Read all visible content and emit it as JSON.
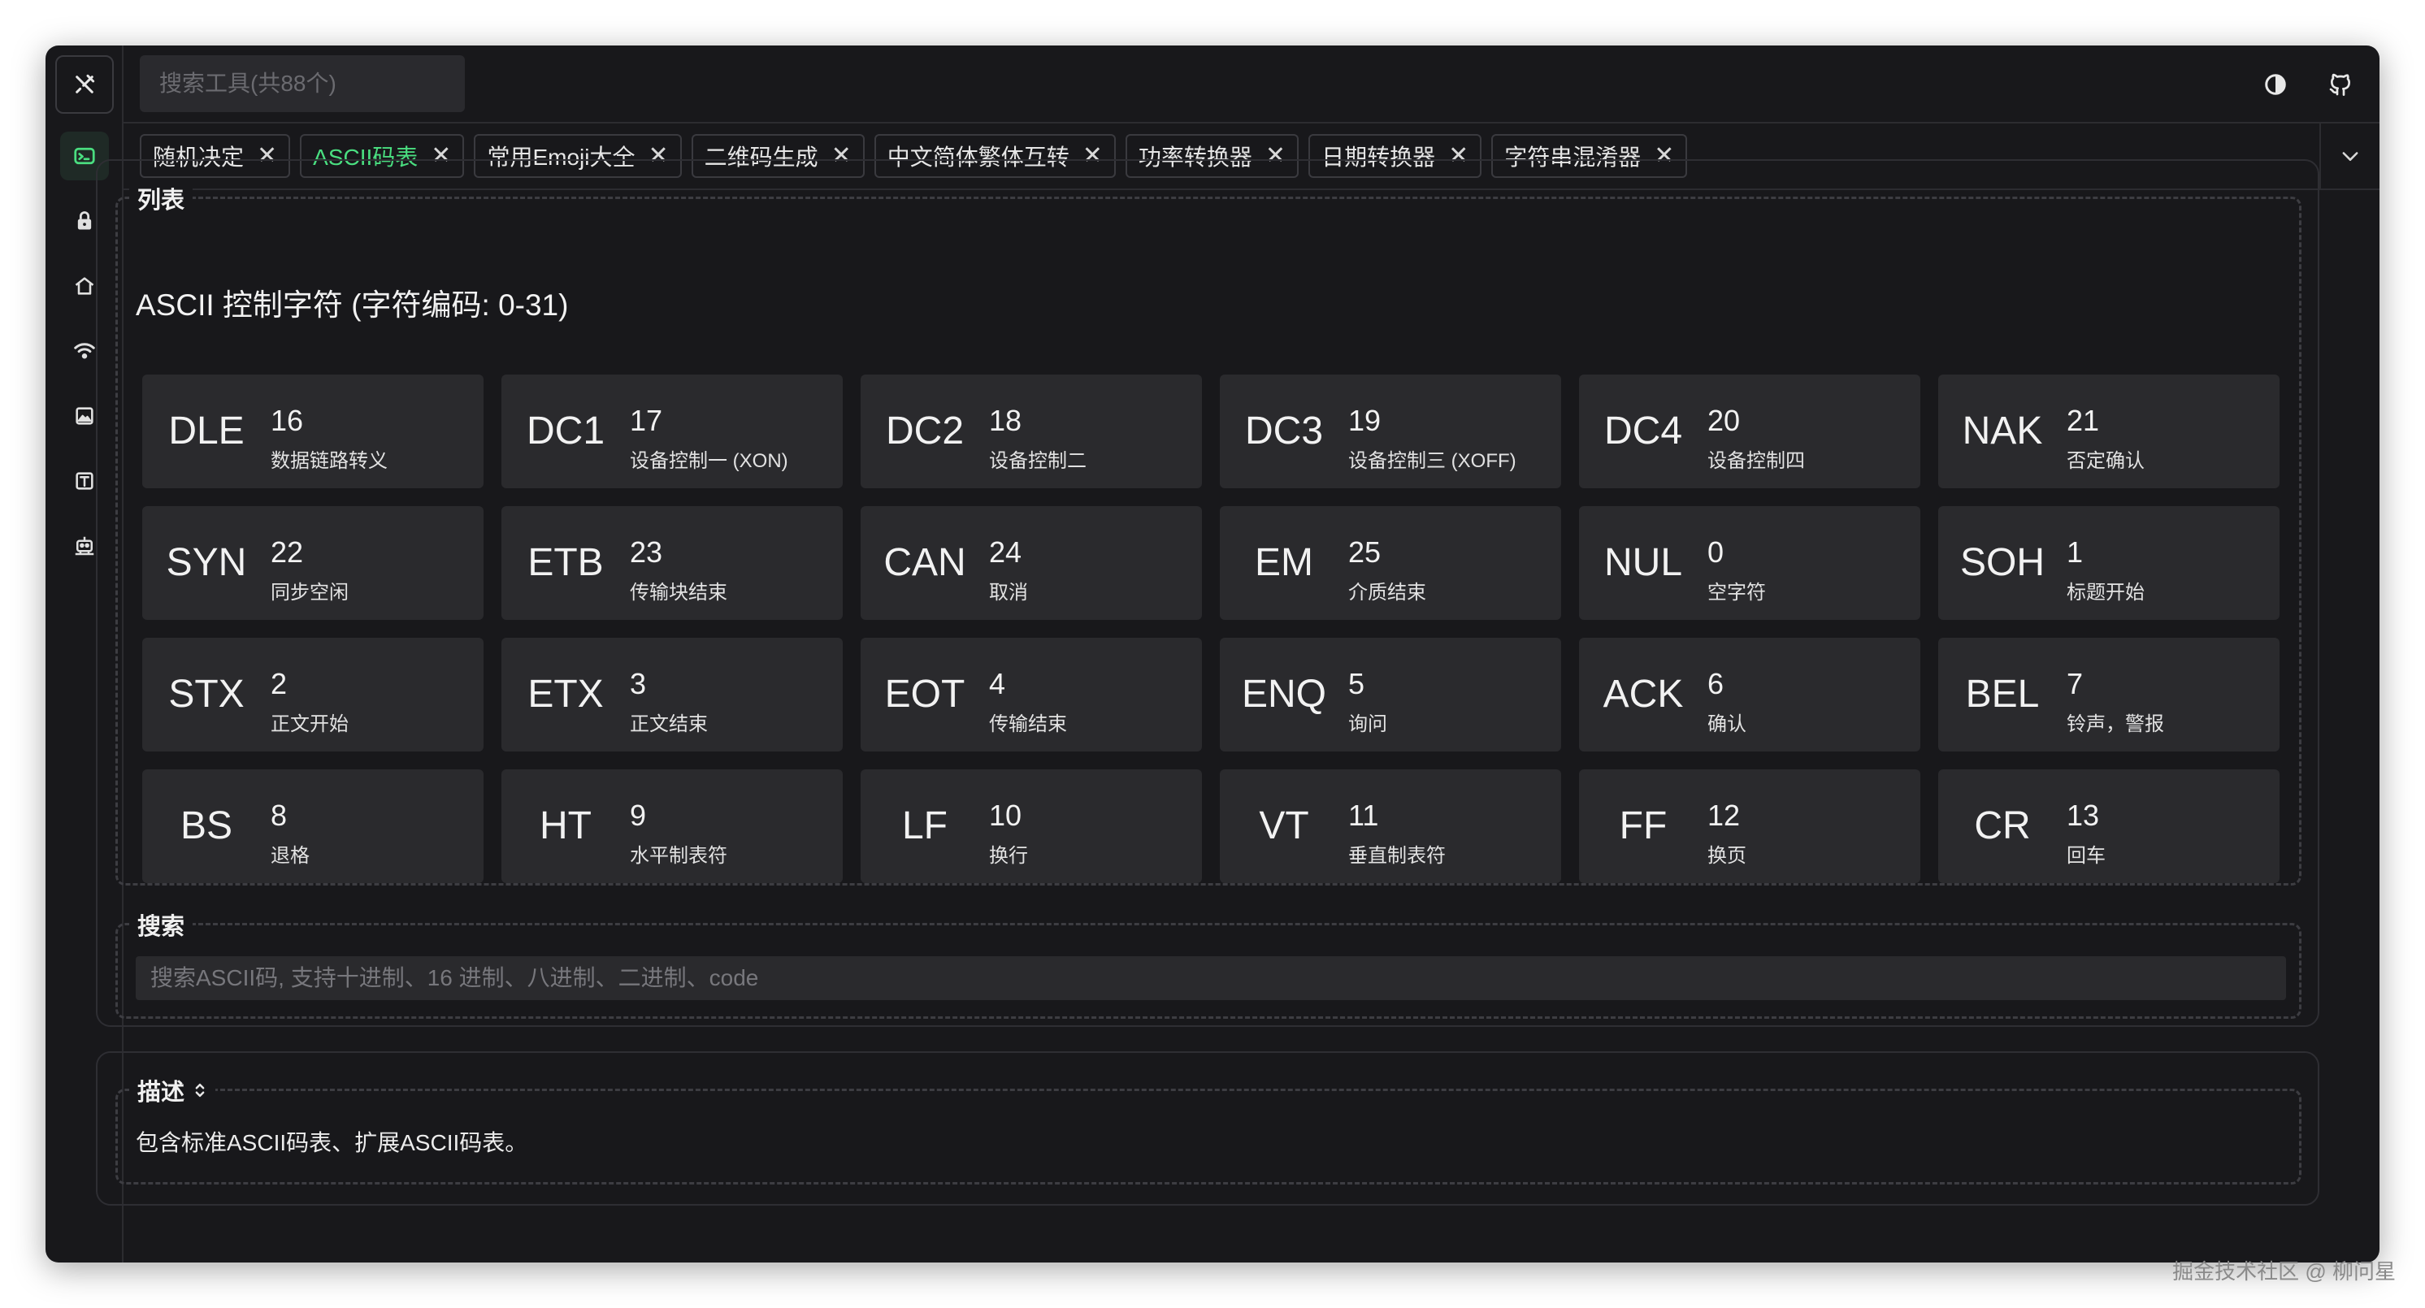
{
  "search_tool": {
    "placeholder": "搜索工具(共88个)"
  },
  "sidebar": {
    "logo_icon": "tools-icon",
    "items": [
      {
        "icon": "terminal-icon",
        "active": true
      },
      {
        "icon": "lock-icon",
        "active": false
      },
      {
        "icon": "home-icon",
        "active": false
      },
      {
        "icon": "wifi-icon",
        "active": false
      },
      {
        "icon": "image-icon",
        "active": false
      },
      {
        "icon": "text-icon",
        "active": false
      },
      {
        "icon": "robot-icon",
        "active": false
      }
    ]
  },
  "topbar": {
    "theme_icon": "theme-toggle-icon",
    "github_icon": "github-icon"
  },
  "tabs": [
    {
      "label": "随机决定",
      "active": false
    },
    {
      "label": "ASCII码表",
      "active": true
    },
    {
      "label": "常用Emoji大全",
      "active": false
    },
    {
      "label": "二维码生成",
      "active": false
    },
    {
      "label": "中文简体繁体互转",
      "active": false
    },
    {
      "label": "功率转换器",
      "active": false
    },
    {
      "label": "日期转换器",
      "active": false
    },
    {
      "label": "字符串混淆器",
      "active": false
    }
  ],
  "list": {
    "legend": "列表",
    "title": "ASCII 控制字符 (字符编码: 0-31)",
    "cards": [
      {
        "abbr": "DLE",
        "code": "16",
        "desc": "数据链路转义"
      },
      {
        "abbr": "DC1",
        "code": "17",
        "desc": "设备控制一 (XON)"
      },
      {
        "abbr": "DC2",
        "code": "18",
        "desc": "设备控制二"
      },
      {
        "abbr": "DC3",
        "code": "19",
        "desc": "设备控制三 (XOFF)"
      },
      {
        "abbr": "DC4",
        "code": "20",
        "desc": "设备控制四"
      },
      {
        "abbr": "NAK",
        "code": "21",
        "desc": "否定确认"
      },
      {
        "abbr": "SYN",
        "code": "22",
        "desc": "同步空闲"
      },
      {
        "abbr": "ETB",
        "code": "23",
        "desc": "传输块结束"
      },
      {
        "abbr": "CAN",
        "code": "24",
        "desc": "取消"
      },
      {
        "abbr": "EM",
        "code": "25",
        "desc": "介质结束"
      },
      {
        "abbr": "NUL",
        "code": "0",
        "desc": "空字符"
      },
      {
        "abbr": "SOH",
        "code": "1",
        "desc": "标题开始"
      },
      {
        "abbr": "STX",
        "code": "2",
        "desc": "正文开始"
      },
      {
        "abbr": "ETX",
        "code": "3",
        "desc": "正文结束"
      },
      {
        "abbr": "EOT",
        "code": "4",
        "desc": "传输结束"
      },
      {
        "abbr": "ENQ",
        "code": "5",
        "desc": "询问"
      },
      {
        "abbr": "ACK",
        "code": "6",
        "desc": "确认"
      },
      {
        "abbr": "BEL",
        "code": "7",
        "desc": "铃声，警报"
      },
      {
        "abbr": "BS",
        "code": "8",
        "desc": "退格"
      },
      {
        "abbr": "HT",
        "code": "9",
        "desc": "水平制表符"
      },
      {
        "abbr": "LF",
        "code": "10",
        "desc": "换行"
      },
      {
        "abbr": "VT",
        "code": "11",
        "desc": "垂直制表符"
      },
      {
        "abbr": "FF",
        "code": "12",
        "desc": "换页"
      },
      {
        "abbr": "CR",
        "code": "13",
        "desc": "回车"
      }
    ]
  },
  "search": {
    "legend": "搜索",
    "placeholder": "搜索ASCII码, 支持十进制、16 进制、八进制、二进制、code"
  },
  "description": {
    "legend": "描述",
    "text": "包含标准ASCII码表、扩展ASCII码表。"
  },
  "watermark": "掘金技术社区 @ 柳问星",
  "colors": {
    "accent": "#4ade80",
    "background": "#18181b",
    "card": "#2a2a2d"
  }
}
